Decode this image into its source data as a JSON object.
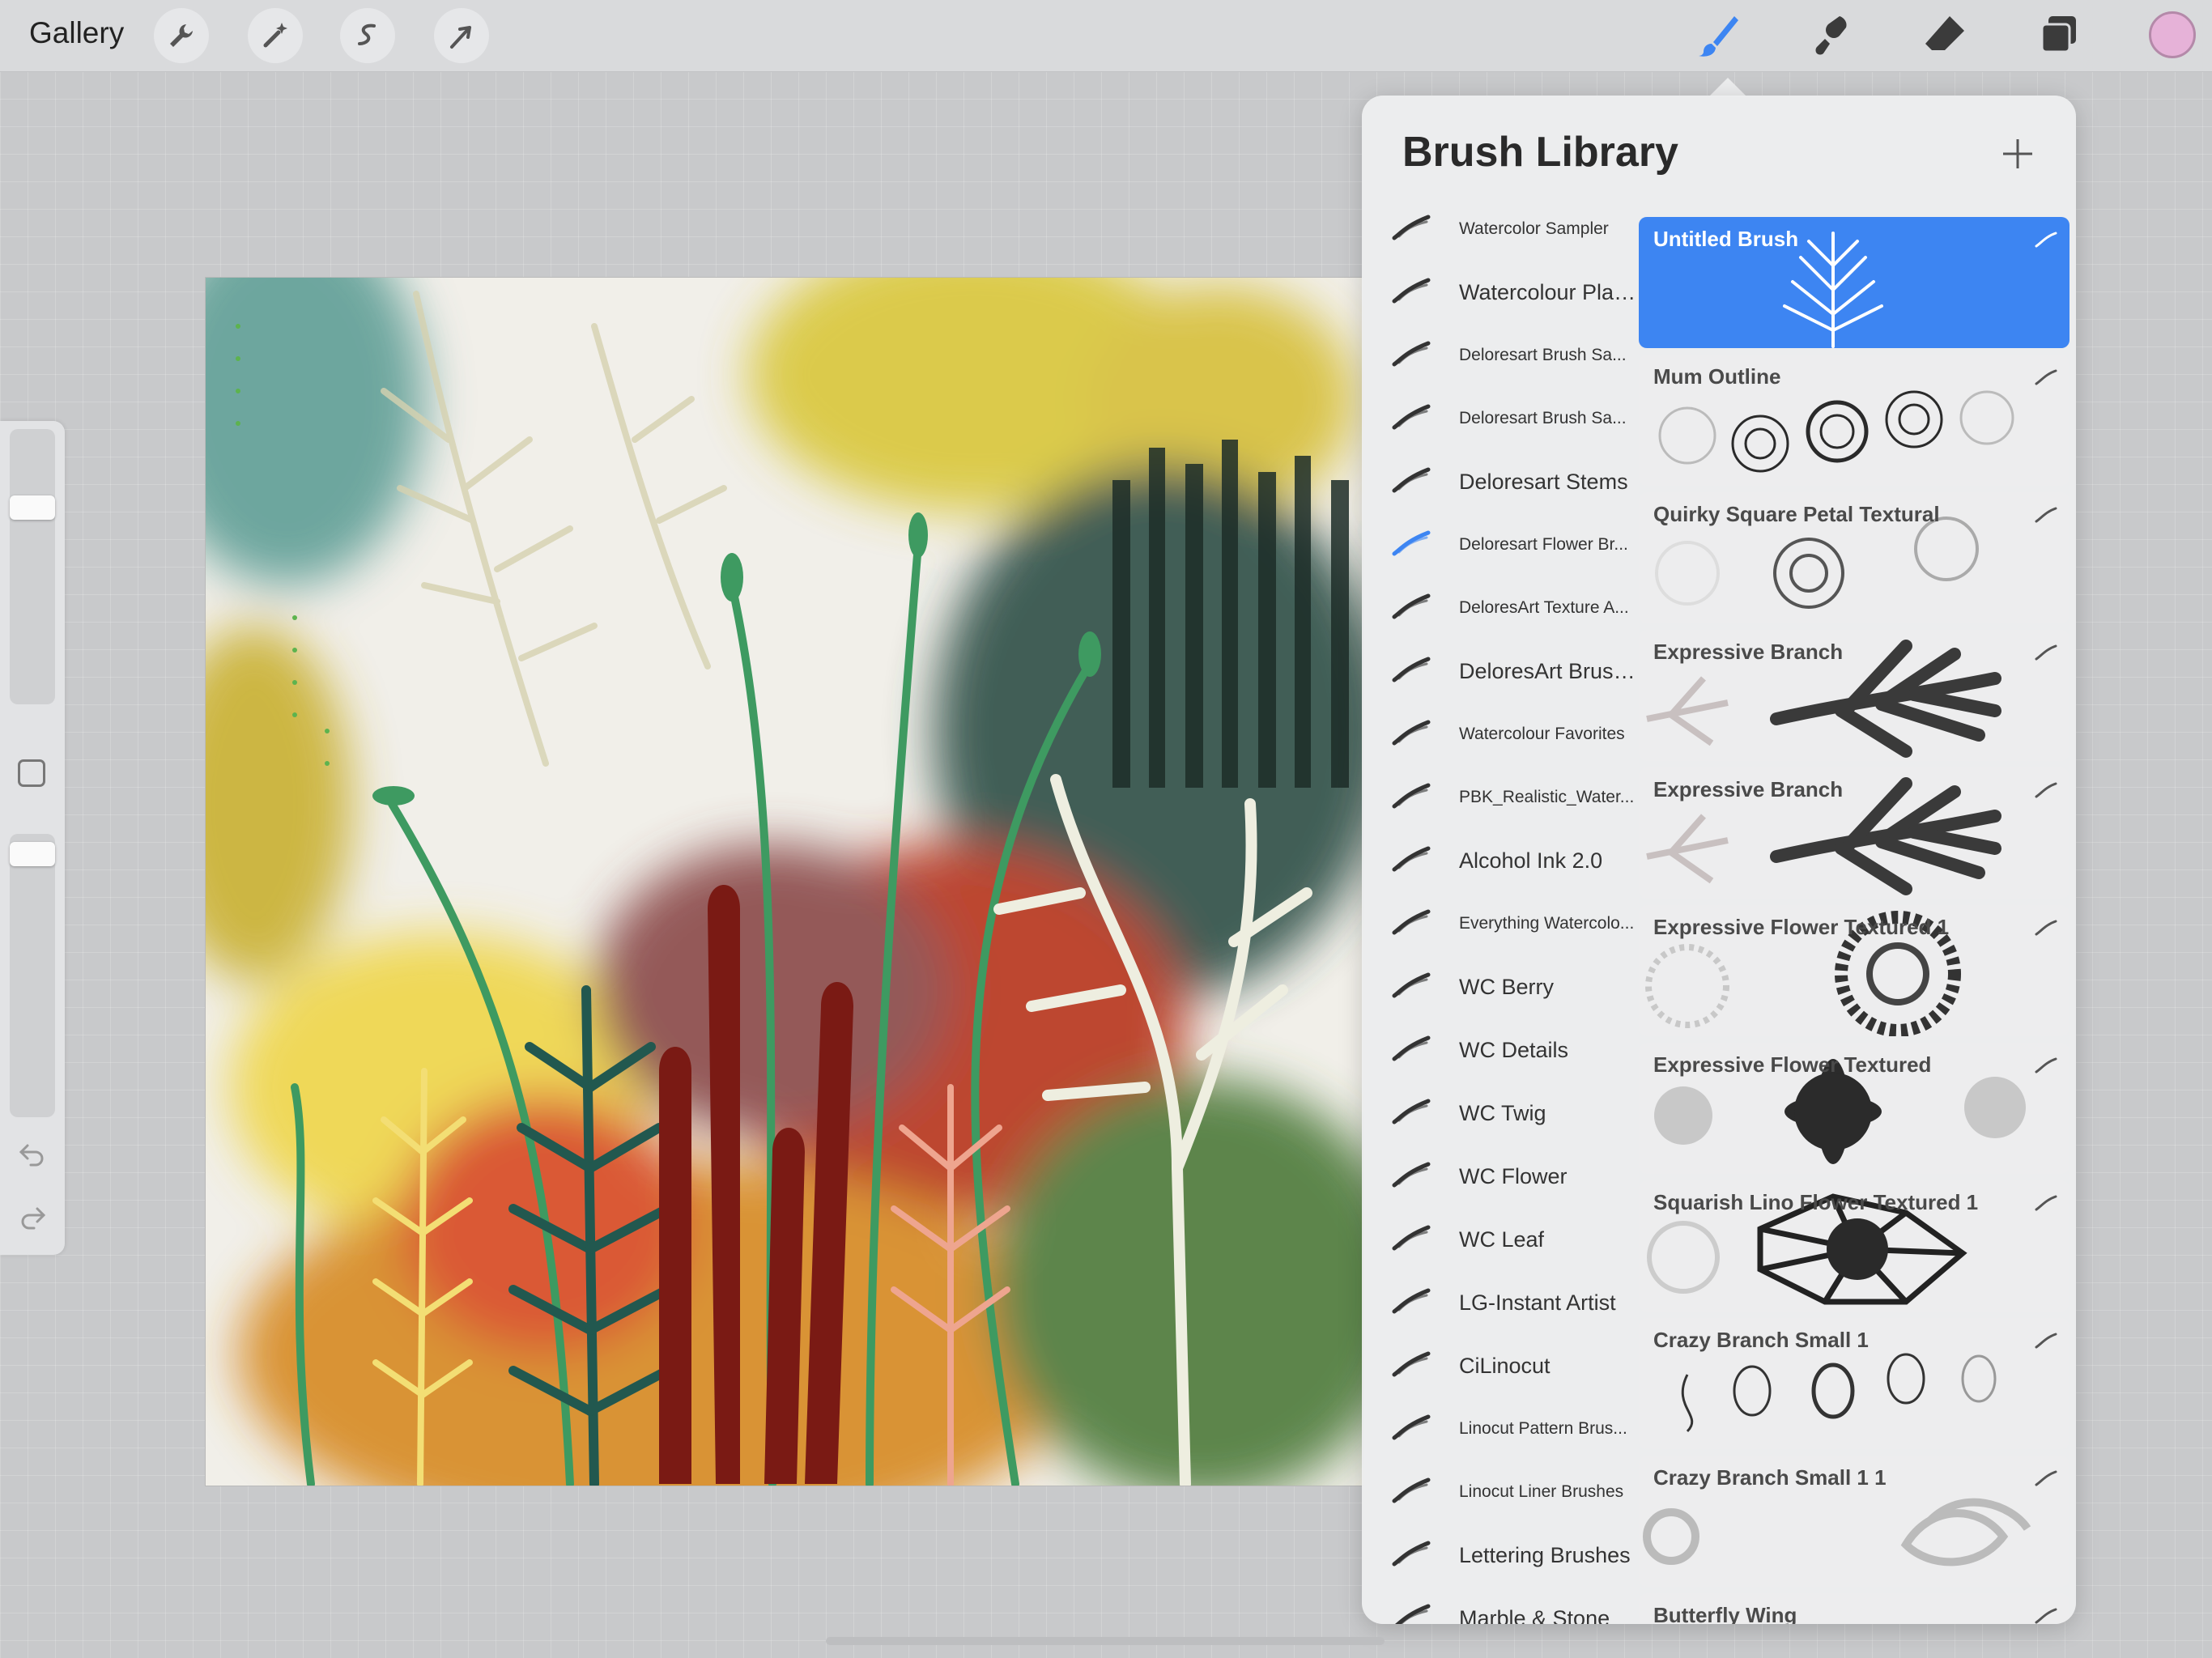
{
  "topbar": {
    "gallery_label": "Gallery",
    "tools": [
      "wrench-icon",
      "magic-wand-icon",
      "selection-icon",
      "transform-icon"
    ],
    "right_tools": [
      "brush-icon",
      "smudge-icon",
      "eraser-icon",
      "layers-icon"
    ],
    "active_tool": "brush-icon",
    "current_color": "#e6b2d8",
    "accent_color": "#3d85f2"
  },
  "sidebar": {
    "brush_size_level": 0.25,
    "opacity_level": 0.0
  },
  "panel": {
    "title": "Brush Library",
    "sets": [
      {
        "label": "Watercolor Sampler",
        "size": "small"
      },
      {
        "label": "Watercolour Plants",
        "size": "big"
      },
      {
        "label": "Deloresart Brush Sa...",
        "size": "small"
      },
      {
        "label": "Deloresart Brush Sa...",
        "size": "small"
      },
      {
        "label": "Deloresart Stems",
        "size": "big"
      },
      {
        "label": "Deloresart Flower Br...",
        "size": "small",
        "active": true
      },
      {
        "label": "DeloresArt Texture A...",
        "size": "small"
      },
      {
        "label": "DeloresArt Brushes",
        "size": "big"
      },
      {
        "label": "Watercolour Favorites",
        "size": "small"
      },
      {
        "label": "PBK_Realistic_Water...",
        "size": "small"
      },
      {
        "label": "Alcohol Ink 2.0",
        "size": "big"
      },
      {
        "label": "Everything Watercolo...",
        "size": "small"
      },
      {
        "label": "WC Berry",
        "size": "big"
      },
      {
        "label": "WC Details",
        "size": "big"
      },
      {
        "label": "WC Twig",
        "size": "big"
      },
      {
        "label": "WC Flower",
        "size": "big"
      },
      {
        "label": "WC Leaf",
        "size": "big"
      },
      {
        "label": "LG-Instant Artist",
        "size": "big"
      },
      {
        "label": "CiLinocut",
        "size": "big"
      },
      {
        "label": "Linocut Pattern Brus...",
        "size": "small"
      },
      {
        "label": "Linocut Liner Brushes",
        "size": "small"
      },
      {
        "label": "Lettering Brushes",
        "size": "big"
      },
      {
        "label": "Marble & Stone",
        "size": "big"
      }
    ],
    "brushes": [
      {
        "name": "Untitled Brush",
        "selected": true,
        "preview": "tree"
      },
      {
        "name": "Mum Outline",
        "preview": "mums"
      },
      {
        "name": "Quirky Square Petal Textural",
        "preview": "quirky"
      },
      {
        "name": "Expressive Branch",
        "preview": "branch"
      },
      {
        "name": "Expressive Branch",
        "preview": "branch"
      },
      {
        "name": "Expressive Flower Textured 1",
        "preview": "flower-rings"
      },
      {
        "name": "Expressive Flower Textured",
        "preview": "daisy"
      },
      {
        "name": "Squarish Lino Flower Textured 1",
        "preview": "lino"
      },
      {
        "name": "Crazy Branch Small 1",
        "preview": "buds"
      },
      {
        "name": "Crazy Branch Small 1 1",
        "preview": "loops"
      },
      {
        "name": "Butterfly Wing",
        "preview": "wing"
      }
    ]
  }
}
